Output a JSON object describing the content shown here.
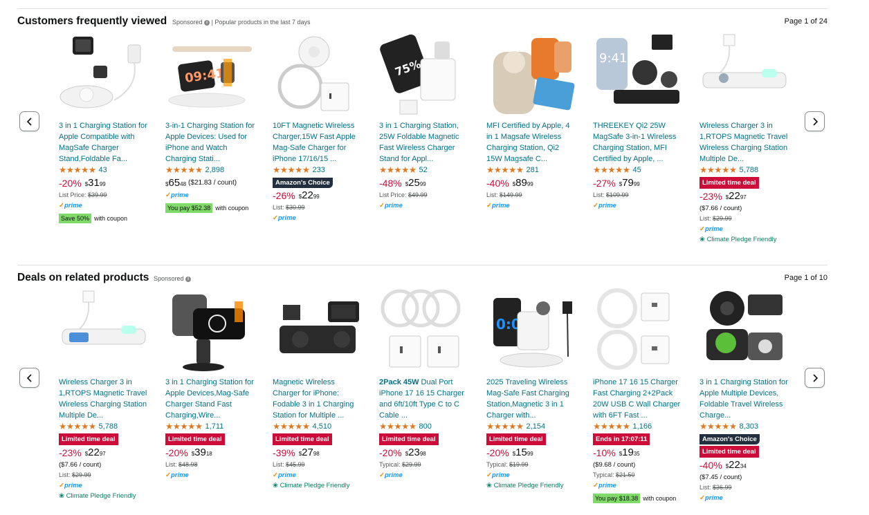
{
  "colors": {
    "link": "#007185",
    "star": "#de7921",
    "deal": "#cc0c39",
    "prime": "#1399ff",
    "coupon": "#7fda69"
  },
  "sections": [
    {
      "title": "Customers frequently viewed",
      "sponsored": "Sponsored",
      "subtitle": "| Popular products in the last 7 days",
      "page": "Page 1 of 24",
      "products": [
        {
          "title": "3 in 1 Charging Station for Apple Compatible with MagSafe Charger Stand,Foldable Fa...",
          "stars": "★★★★★",
          "reviews": "43",
          "discount": "-20%",
          "price_whole": "31",
          "price_frac": "99",
          "list_label": "List Price:",
          "list_price": "$39.99",
          "prime": "prime",
          "coupon_badge": "Save 50%",
          "coupon_text": "with coupon"
        },
        {
          "title": "3-in-1 Charging Station for Apple Devices: Used for iPhone and Watch Charging Stati...",
          "stars": "★★★★★",
          "reviews": "2,898",
          "price_whole": "65",
          "price_frac": "48",
          "unit": "($21.83 / count)",
          "prime": "prime",
          "coupon_badge": "You pay $52.38",
          "coupon_text": "with coupon"
        },
        {
          "title": "10FT Magnetic Wireless Charger,15W Fast Apple Mag-Safe Charger for iPhone 17/16/15 ...",
          "stars": "★★★★★",
          "reviews": "233",
          "choice": "Amazon's Choice",
          "discount": "-26%",
          "price_whole": "22",
          "price_frac": "99",
          "list_label": "List:",
          "list_price": "$30.99",
          "prime": "prime"
        },
        {
          "title": "3 in 1 Charging Station, 25W Foldable Magnetic Fast Wireless Charger Stand for Appl...",
          "stars": "★★★★★",
          "reviews": "52",
          "discount": "-48%",
          "price_whole": "25",
          "price_frac": "99",
          "list_label": "List Price:",
          "list_price": "$49.99",
          "prime": "prime"
        },
        {
          "title": "MFI Certified by Apple, 4 in 1 Magsafe Wireless Charging Station, Qi2 15W Magsafe C...",
          "stars": "★★★★★",
          "reviews": "281",
          "discount": "-40%",
          "price_whole": "89",
          "price_frac": "99",
          "list_label": "List:",
          "list_price": "$149.99",
          "prime": "prime"
        },
        {
          "title": "THREEKEY Qi2 25W MagSafe 3-in-1 Wireless Charging Station, MFI Certified by Apple, ...",
          "stars": "★★★★★",
          "reviews": "45",
          "discount": "-27%",
          "price_whole": "79",
          "price_frac": "99",
          "list_label": "List:",
          "list_price": "$109.99",
          "prime": "prime"
        },
        {
          "title": "Wireless Charger 3 in 1,RTOPS Magnetic Travel Wireless Charging Station Multiple De...",
          "stars": "★★★★★",
          "reviews": "5,788",
          "deal": "Limited time deal",
          "discount": "-23%",
          "price_whole": "22",
          "price_frac": "97",
          "unit_line": "($7.66 / count)",
          "list_label": "List:",
          "list_price": "$29.99",
          "prime": "prime",
          "climate": "Climate Pledge Friendly"
        }
      ]
    },
    {
      "title": "Deals on related products",
      "sponsored": "Sponsored",
      "page": "Page 1 of 10",
      "products": [
        {
          "title": "Wireless Charger 3 in 1,RTOPS Magnetic Travel Wireless Charging Station Multiple De...",
          "stars": "★★★★★",
          "reviews": "5,788",
          "deal": "Limited time deal",
          "discount": "-23%",
          "price_whole": "22",
          "price_frac": "97",
          "unit_line": "($7.66 / count)",
          "list_label": "List:",
          "list_price": "$29.99",
          "prime": "prime",
          "climate": "Climate Pledge Friendly"
        },
        {
          "title": "3 in 1 Charging Station for Apple Devices,Mag-Safe Charger Stand Fast Charging,Wire...",
          "stars": "★★★★★",
          "reviews": "1,711",
          "deal": "Limited time deal",
          "discount": "-20%",
          "price_whole": "39",
          "price_frac": "18",
          "list_label": "List:",
          "list_price": "$48.98",
          "prime": "prime"
        },
        {
          "title": "Magnetic Wireless Charger for iPhone: Fodable 3 in 1 Charging Station for Multiple ...",
          "stars": "★★★★★",
          "reviews": "4,510",
          "deal": "Limited time deal",
          "discount": "-39%",
          "price_whole": "27",
          "price_frac": "98",
          "list_label": "List:",
          "list_price": "$45.99",
          "prime": "prime",
          "climate": "Climate Pledge Friendly"
        },
        {
          "title_bold": "2Pack 45W",
          "title": " Dual Port iPhone 17 16 15 Charger and 6ft/10ft Type C to C Cable ...",
          "stars": "★★★★★",
          "reviews": "800",
          "deal": "Limited time deal",
          "discount": "-20%",
          "price_whole": "23",
          "price_frac": "98",
          "list_label": "Typical:",
          "list_price": "$29.99",
          "prime": "prime"
        },
        {
          "title": "2025 Traveling Wireless Mag-Safe Fast Charging Station,Magnetic 3 in 1 Charger with...",
          "stars": "★★★★★",
          "reviews": "2,154",
          "deal": "Limited time deal",
          "discount": "-20%",
          "price_whole": "15",
          "price_frac": "99",
          "list_label": "Typical:",
          "list_price": "$19.99",
          "prime": "prime",
          "climate": "Climate Pledge Friendly"
        },
        {
          "title": "iPhone 17 16 15 Charger Fast Charging 2+2Pack 20W USB C Wall Charger with 6FT Fast ...",
          "stars": "★★★★★",
          "reviews": "1,166",
          "deal": "Ends in 17:07:11",
          "discount": "-10%",
          "price_whole": "19",
          "price_frac": "35",
          "unit_line": "($9.68 / count)",
          "list_label": "Typical:",
          "list_price": "$21.50",
          "prime": "prime",
          "coupon_badge": "You pay $18.38",
          "coupon_text": "with coupon"
        },
        {
          "title": "3 in 1 Charging Station for Apple Multiple Devices, Foldable Travel Wireless Charge...",
          "stars": "★★★★★",
          "reviews": "8,303",
          "choice": "Amazon's Choice",
          "deal": "Limited time deal",
          "discount": "-40%",
          "price_whole": "22",
          "price_frac": "34",
          "unit_line": "($7.45 / count)",
          "list_label": "List:",
          "list_price": "$36.99",
          "prime": "prime"
        }
      ]
    }
  ],
  "icons": {
    "prev": "chevron-left-icon",
    "next": "chevron-right-icon",
    "info": "info-icon",
    "prime_check": "prime-check-icon",
    "leaf": "leaf-icon"
  }
}
